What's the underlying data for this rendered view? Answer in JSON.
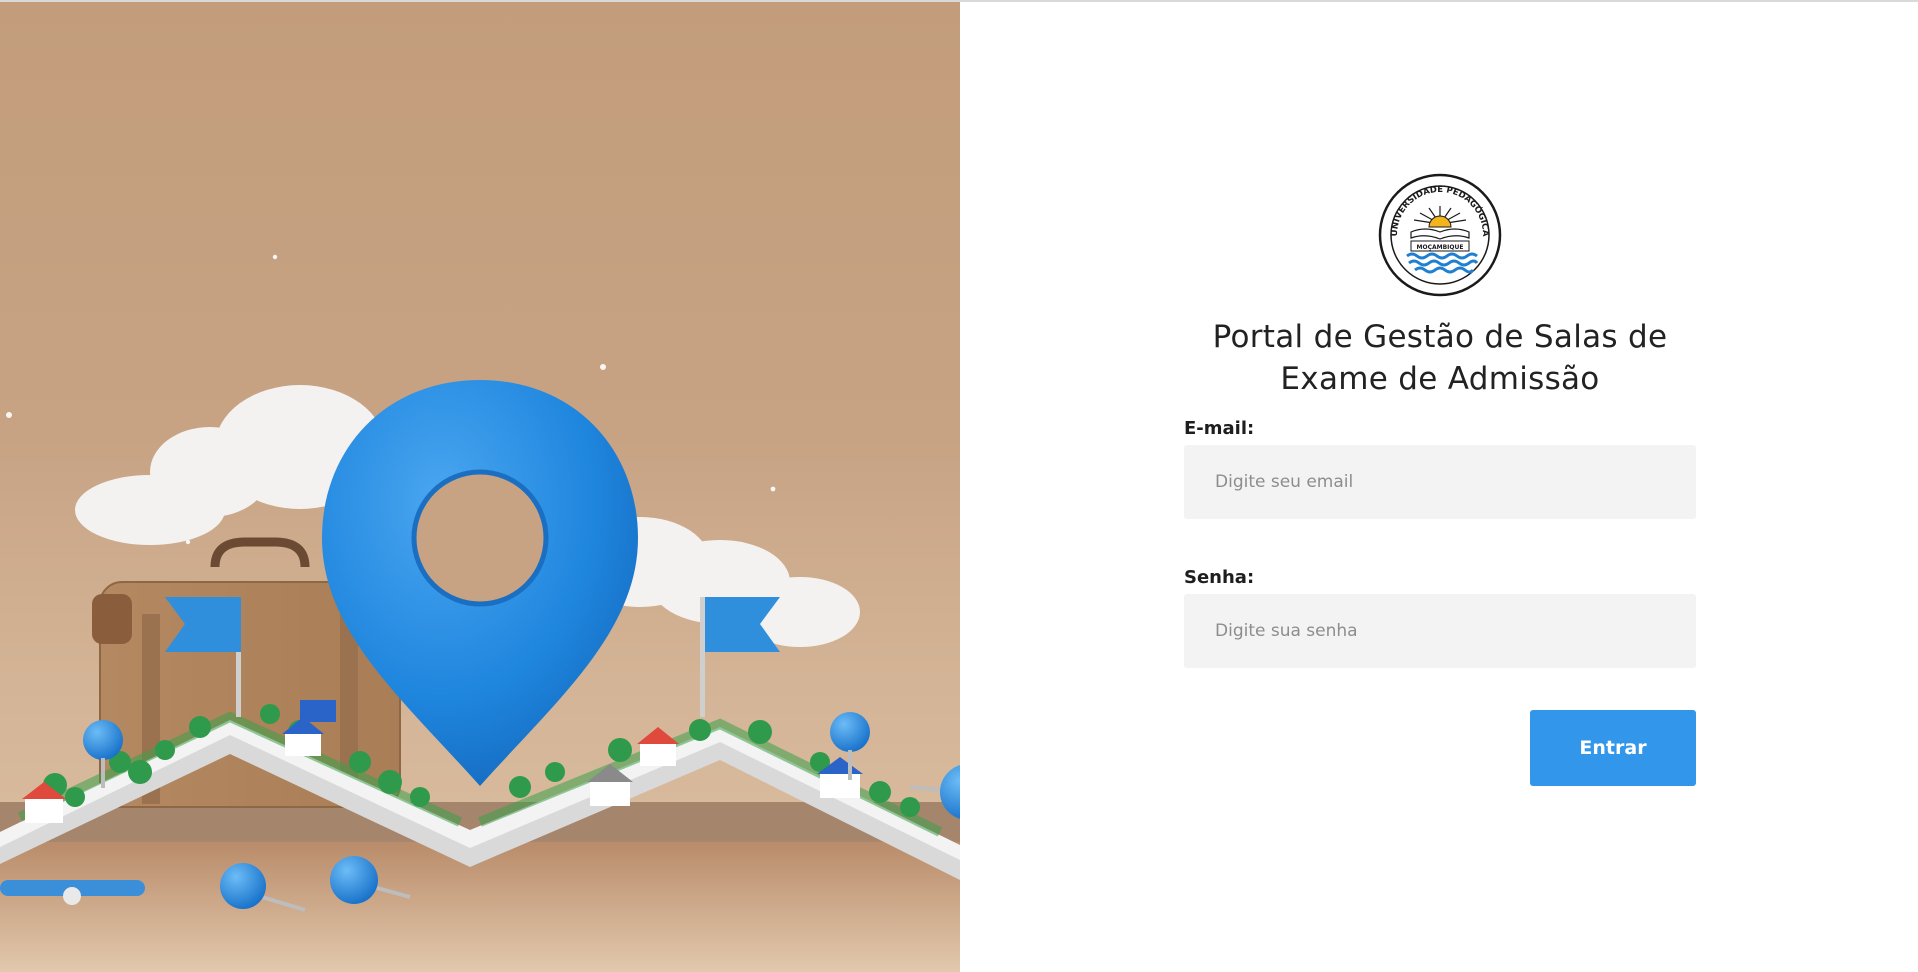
{
  "hero": {
    "image_description_icon": "map-location-pin-illustration",
    "accent_color": "#2f8fdd"
  },
  "logo": {
    "ring_text": "UNIVERSIDADE PEDAGÓGICA",
    "banner_text": "MOÇAMBIQUE",
    "icon": "university-seal-logo"
  },
  "login": {
    "title": "Portal de Gestão de Salas de Exame de Admissão",
    "email_label": "E-mail:",
    "email_placeholder": "Digite seu email",
    "email_value": "",
    "password_label": "Senha:",
    "password_placeholder": "Digite sua senha",
    "password_value": "",
    "submit_label": "Entrar",
    "button_color": "#3296ea"
  }
}
